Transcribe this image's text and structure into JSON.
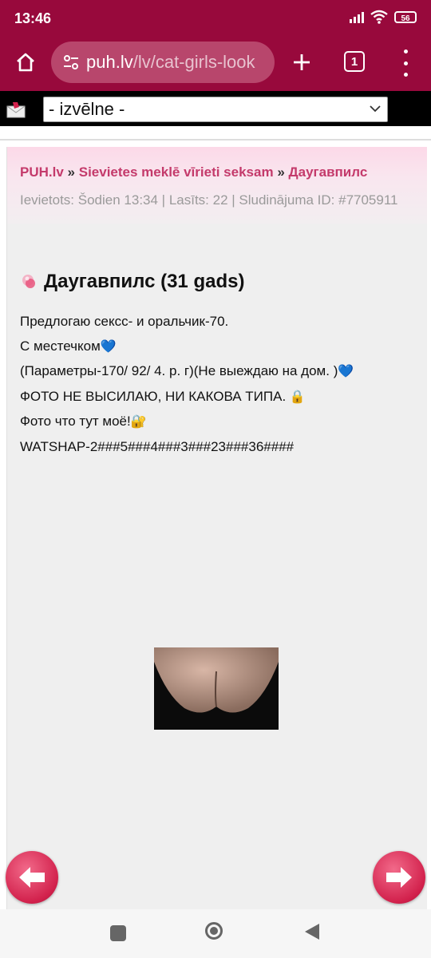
{
  "status_bar": {
    "time": "13:46",
    "battery": "56"
  },
  "browser": {
    "url_host": "puh.lv",
    "url_path": "/lv/cat-girls-look",
    "tab_count": "1"
  },
  "site_nav": {
    "select_value": "- izvēlne -"
  },
  "breadcrumb": {
    "home": "PUH.lv",
    "separator": "»",
    "category": "Sievietes meklē vīrieti seksam",
    "city": "Даугавпилс"
  },
  "meta": {
    "line": "Ievietots: Šodien 13:34 | Lasīts: 22 | Sludinājuma ID: #7705911"
  },
  "ad": {
    "title": "Даугавпилс (31 gads)",
    "lines": [
      "Предлогаю сексс- и оральчик-70.",
      "С местечком",
      "(Параметры-170/ 92/ 4. р. г)(Не выеждаю на дом. )",
      "ФОТО НЕ ВЫСИЛАЮ, НИ КАКОВА ТИПА.",
      "Фото что тут моё!",
      "WATSHAP-2###5###4###3###23###36####"
    ],
    "emojis": {
      "heart": "💙",
      "lock": "🔒",
      "lock_key": "🔐"
    }
  },
  "colors": {
    "brand": "#98093c",
    "link": "#c43a6b",
    "arrow_button": "#d2214c"
  },
  "icons": {
    "home": "home-icon",
    "site_info": "tune-icon",
    "new_tab": "plus-icon",
    "menu": "more-vert-icon",
    "prev": "arrow-left-icon",
    "next": "arrow-right-icon"
  }
}
